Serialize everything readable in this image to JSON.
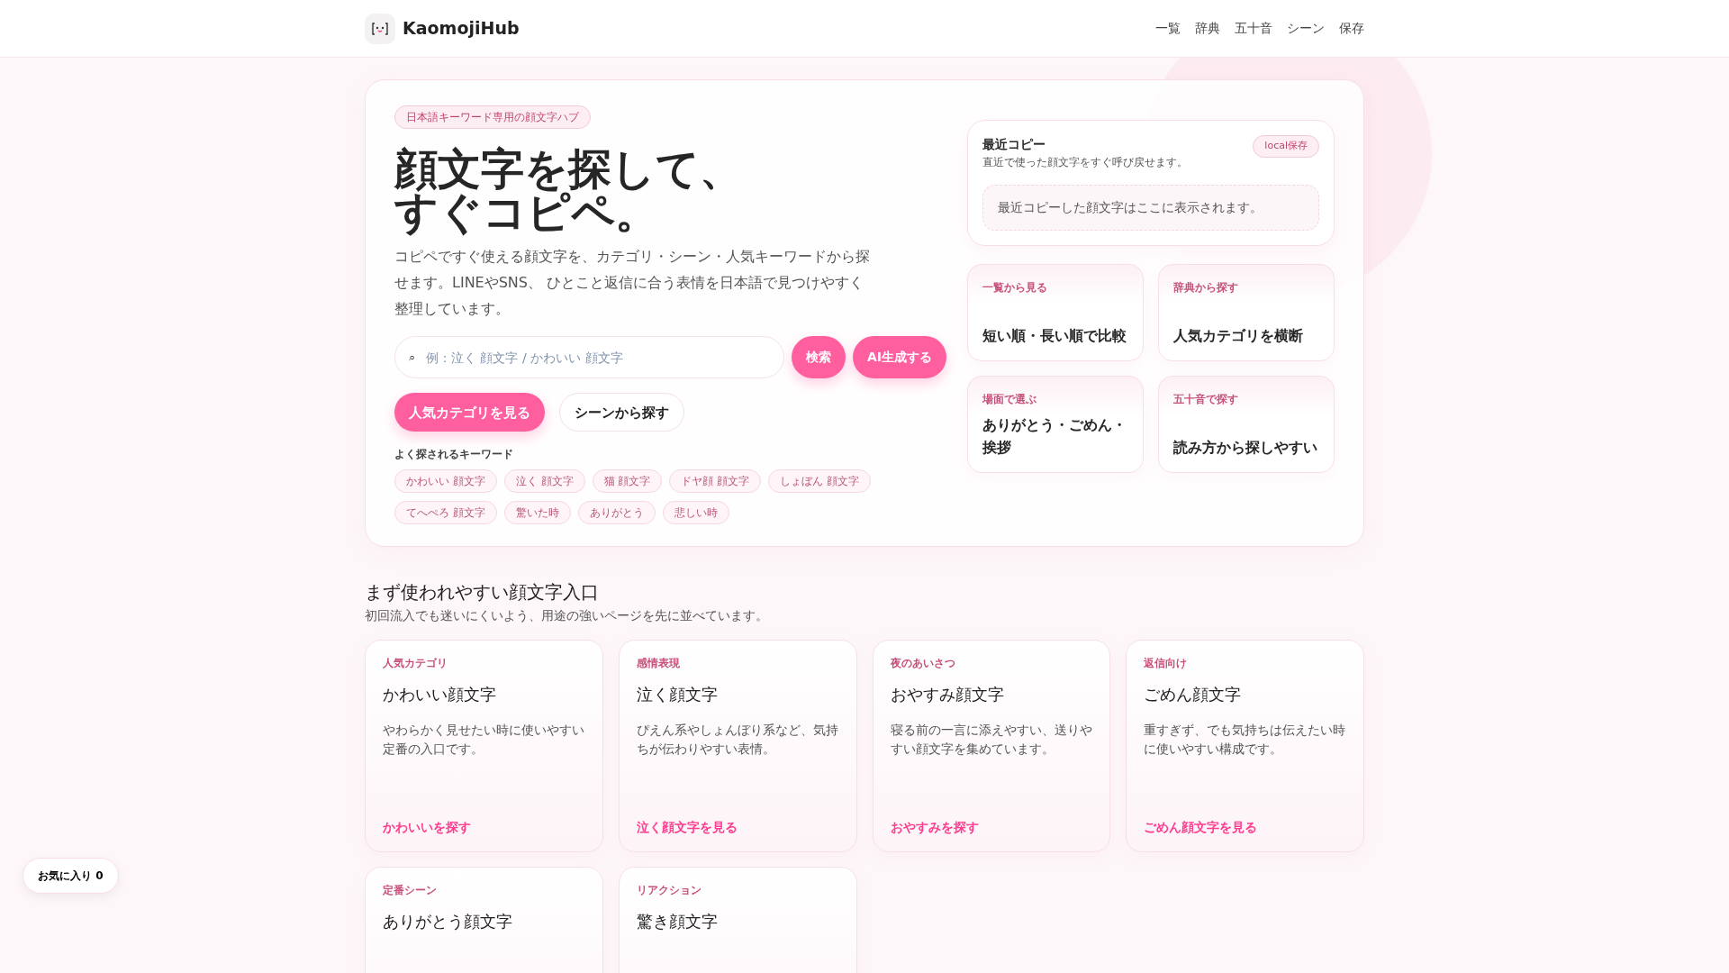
{
  "header": {
    "logo_text": "KaomojiHub",
    "nav": [
      {
        "label": "一覧"
      },
      {
        "label": "辞典"
      },
      {
        "label": "五十音"
      },
      {
        "label": "シーン"
      },
      {
        "label": "保存"
      }
    ]
  },
  "hero": {
    "eyebrow": "日本語キーワード専用の顔文字ハブ",
    "title_lines": [
      "顔文字を探して、",
      "すぐコピペ。"
    ],
    "lead": "コピペですぐ使える顔文字を、カテゴリ・シーン・人気キーワードから探せます。LINEやSNS、 ひとこと返信に合う表情を日本語で見つけやすく整理しています。",
    "search": {
      "icon": "⌕",
      "placeholder": "例：泣く 顔文字 / かわいい 顔文字",
      "buttons": [
        "検索",
        "AI生成する"
      ]
    },
    "actions": [
      {
        "label": "人気カテゴリを見る",
        "kind": "primary"
      },
      {
        "label": "シーンから探す",
        "kind": "outline"
      }
    ],
    "keywords_title": "よく探されるキーワード",
    "keywords": [
      "かわいい 顔文字",
      "泣く 顔文字",
      "猫 顔文字",
      "ドヤ顔 顔文字",
      "しょぼん 顔文字",
      "てへぺろ 顔文字",
      "驚いた時",
      "ありがとう",
      "悲しい時"
    ]
  },
  "recent": {
    "title": "最近コピー",
    "subtitle": "直近で使った顔文字をすぐ呼び戻せます。",
    "badge": "local保存",
    "empty": "最近コピーした顔文字はここに表示されます。"
  },
  "quick_links": [
    {
      "label": "一覧から見る",
      "title": "短い順・長い順で比較"
    },
    {
      "label": "辞典から探す",
      "title": "人気カテゴリを横断"
    },
    {
      "label": "場面で選ぶ",
      "title": "ありがとう・ごめん・挨拶"
    },
    {
      "label": "五十音で探す",
      "title": "読み方から探しやすい"
    }
  ],
  "section": {
    "title": "まず使われやすい顔文字入口",
    "subtitle": "初回流入でも迷いにくいよう、用途の強いページを先に並べています。",
    "cards": [
      {
        "label": "人気カテゴリ",
        "title": "かわいい顔文字",
        "text": "やわらかく見せたい時に使いやすい定番の入口です。",
        "link": "かわいいを探す"
      },
      {
        "label": "感情表現",
        "title": "泣く顔文字",
        "text": "ぴえん系やしょんぼり系など、気持ちが伝わりやすい表情。",
        "link": "泣く顔文字を見る"
      },
      {
        "label": "夜のあいさつ",
        "title": "おやすみ顔文字",
        "text": "寝る前の一言に添えやすい、送りやすい顔文字を集めています。",
        "link": "おやすみを探す"
      },
      {
        "label": "返信向け",
        "title": "ごめん顔文字",
        "text": "重すぎず、でも気持ちは伝えたい時に使いやすい構成です。",
        "link": "ごめん顔文字を見る"
      },
      {
        "label": "定番シーン",
        "title": "ありがとう顔文字"
      },
      {
        "label": "リアクション",
        "title": "驚き顔文字"
      }
    ]
  },
  "favorites": {
    "label": "お気に入り 0"
  }
}
